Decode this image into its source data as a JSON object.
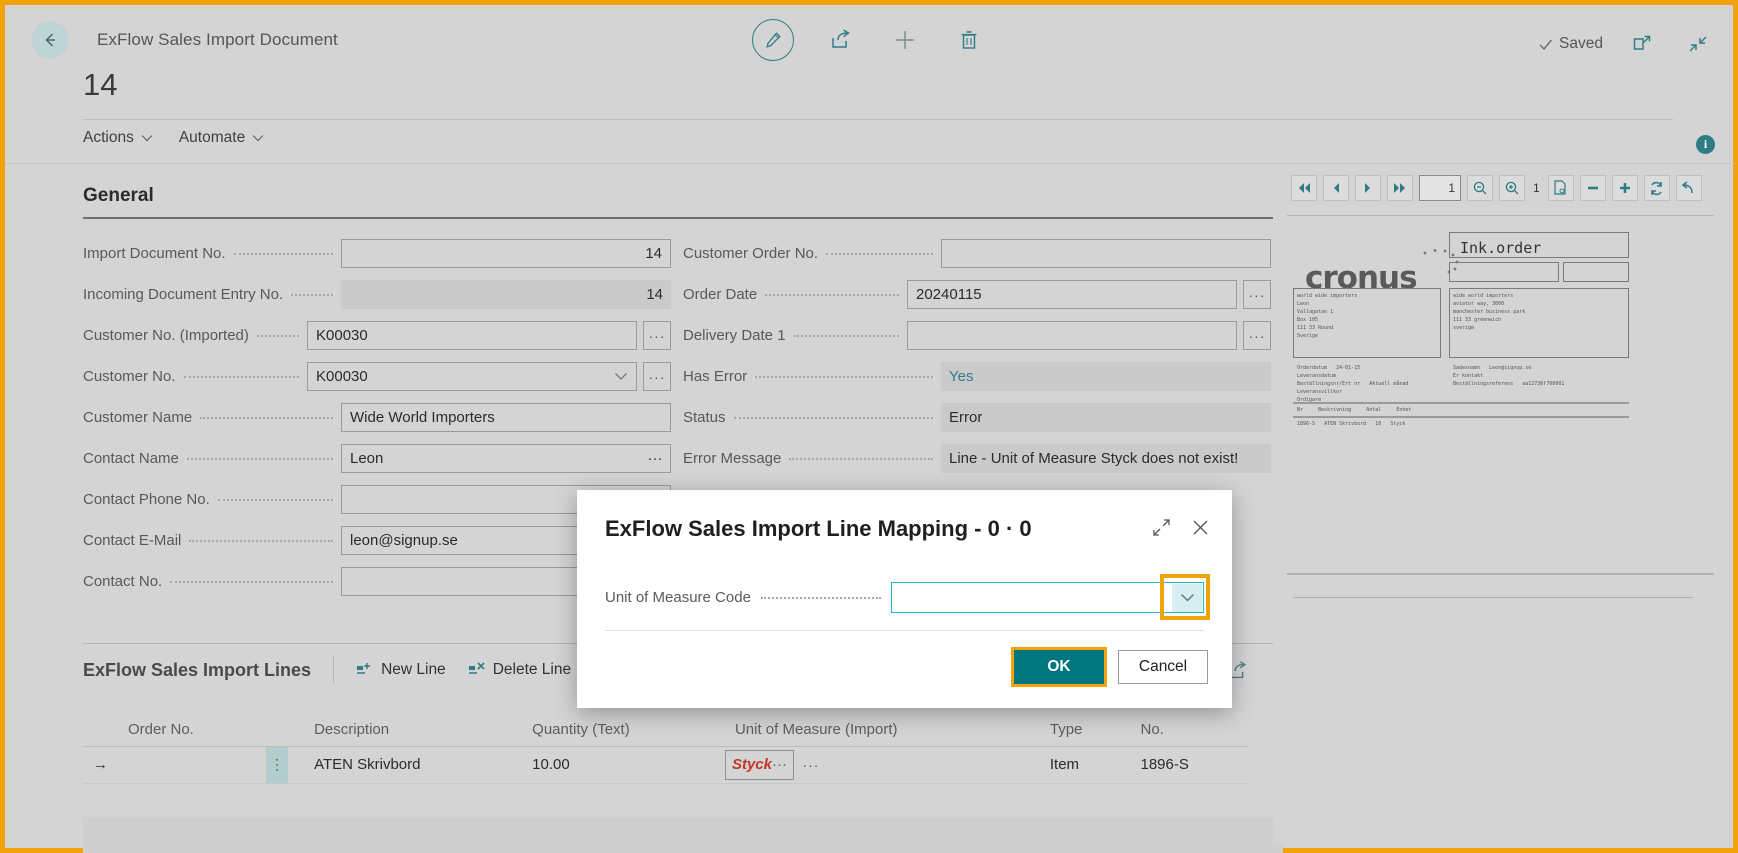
{
  "topbar": {
    "breadcrumb": "ExFlow Sales Import Document",
    "saved_label": "Saved",
    "back_icon": "back-arrow-icon",
    "edit_icon": "pencil-edit-icon",
    "share_icon": "share-icon",
    "add_icon": "plus-icon",
    "delete_icon": "trash-icon",
    "open_new_icon": "open-in-new-window-icon",
    "collapse_icon": "collapse-icon"
  },
  "document": {
    "number": "14"
  },
  "actionbar": {
    "actions_label": "Actions",
    "automate_label": "Automate",
    "info_label": "i"
  },
  "general": {
    "section_label": "General",
    "left_fields": [
      {
        "label": "Import Document No.",
        "value": "14",
        "align": "right",
        "readonly": false,
        "control": "none"
      },
      {
        "label": "Incoming Document Entry No.",
        "value": "14",
        "align": "right",
        "readonly": true,
        "control": "none"
      },
      {
        "label": "Customer No. (Imported)",
        "value": "K00030",
        "align": "left",
        "readonly": false,
        "control": "ellipsis"
      },
      {
        "label": "Customer No.",
        "value": "K00030",
        "align": "left",
        "readonly": false,
        "control": "dropdown-ellipsis"
      },
      {
        "label": "Customer Name",
        "value": "Wide World Importers",
        "align": "left",
        "readonly": false,
        "control": "none"
      },
      {
        "label": "Contact Name",
        "value": "Leon",
        "align": "left",
        "readonly": false,
        "control": "inline-ellipsis"
      },
      {
        "label": "Contact Phone No.",
        "value": "",
        "align": "left",
        "readonly": false,
        "control": "none"
      },
      {
        "label": "Contact E-Mail",
        "value": "leon@signup.se",
        "align": "left",
        "readonly": false,
        "control": "none"
      },
      {
        "label": "Contact No.",
        "value": "",
        "align": "left",
        "readonly": false,
        "control": "none"
      }
    ],
    "right_fields": [
      {
        "label": "Customer Order No.",
        "value": "",
        "readonly": false,
        "control": "none",
        "teal": false
      },
      {
        "label": "Order Date",
        "value": "20240115",
        "readonly": false,
        "control": "ellipsis",
        "teal": false
      },
      {
        "label": "Delivery Date 1",
        "value": "",
        "readonly": false,
        "control": "ellipsis",
        "teal": false
      },
      {
        "label": "Has Error",
        "value": "Yes",
        "readonly": true,
        "control": "none",
        "teal": true
      },
      {
        "label": "Status",
        "value": "Error",
        "readonly": true,
        "control": "none",
        "teal": false
      },
      {
        "label": "Error Message",
        "value": "Line - Unit of Measure Styck does not exist!",
        "readonly": true,
        "control": "none",
        "teal": false
      }
    ]
  },
  "lines": {
    "title": "ExFlow Sales Import Lines",
    "new_line_label": "New Line",
    "delete_line_label": "Delete Line",
    "new_line_icon": "new-line-icon",
    "delete_line_icon": "delete-line-icon",
    "share_icon": "share-icon",
    "open_icon": "open-in-new-window-icon",
    "columns": [
      "Order No.",
      "Description",
      "Quantity (Text)",
      "Unit of Measure (Import)",
      "Type",
      "No."
    ],
    "rows": [
      {
        "order_no": "",
        "description": "ATEN Skrivbord",
        "quantity": "10.00",
        "unit_of_measure": "Styck",
        "type": "Item",
        "no": "1896-S",
        "uom_error": true
      }
    ]
  },
  "preview": {
    "page_value": "1",
    "page_count": "1",
    "buttons": [
      "first-page-icon",
      "previous-page-icon",
      "next-page-icon",
      "last-page-icon",
      "zoom-out-icon",
      "zoom-in-icon",
      "fit-page-icon",
      "minus-icon",
      "plus-icon",
      "refresh-icon",
      "undo-icon"
    ],
    "logo_text": "cronus",
    "doc_heading": "Ink.order",
    "address_left": [
      "world wide importers",
      "Leon",
      "Vallagatan 1",
      "Box 105",
      "111 33 Round",
      "Sverige"
    ],
    "address_right": [
      "wide world importers",
      "aviator way, 3000",
      "manchester business park",
      "111 33 greenwich",
      "sverige"
    ],
    "meta_left": [
      [
        "Orderdatum",
        "24-01-15"
      ],
      [
        "Leveransdatum",
        ""
      ],
      [
        "Beställningsnr/Ert nr",
        "Aktuell månad"
      ],
      [
        "Leveransvillkor",
        ""
      ],
      [
        "Ordigare",
        ""
      ]
    ],
    "meta_right": [
      [
        "Sadesnamn",
        "Leon@signup.se"
      ],
      [
        "Er kontakt",
        ""
      ],
      [
        "Beställningsreferens",
        "aa12736f760001"
      ]
    ],
    "table_head": [
      "Nr",
      "Beskrivning",
      "Antal",
      "Enhet"
    ],
    "table_row": [
      "1896-S",
      "ATEN Skrivbord",
      "10",
      "Styck"
    ]
  },
  "modal": {
    "title": "ExFlow Sales Import Line Mapping - 0 · 0",
    "expand_icon": "expand-icon",
    "close_icon": "close-icon",
    "field_label": "Unit of Measure Code",
    "field_value": "",
    "dropdown_icon": "chevron-down-icon",
    "ok_label": "OK",
    "cancel_label": "Cancel"
  },
  "colors": {
    "accent_teal": "#2e7d86",
    "highlight_orange": "#f0a30a",
    "error_red": "#c0392b",
    "ok_button": "#00767f"
  }
}
